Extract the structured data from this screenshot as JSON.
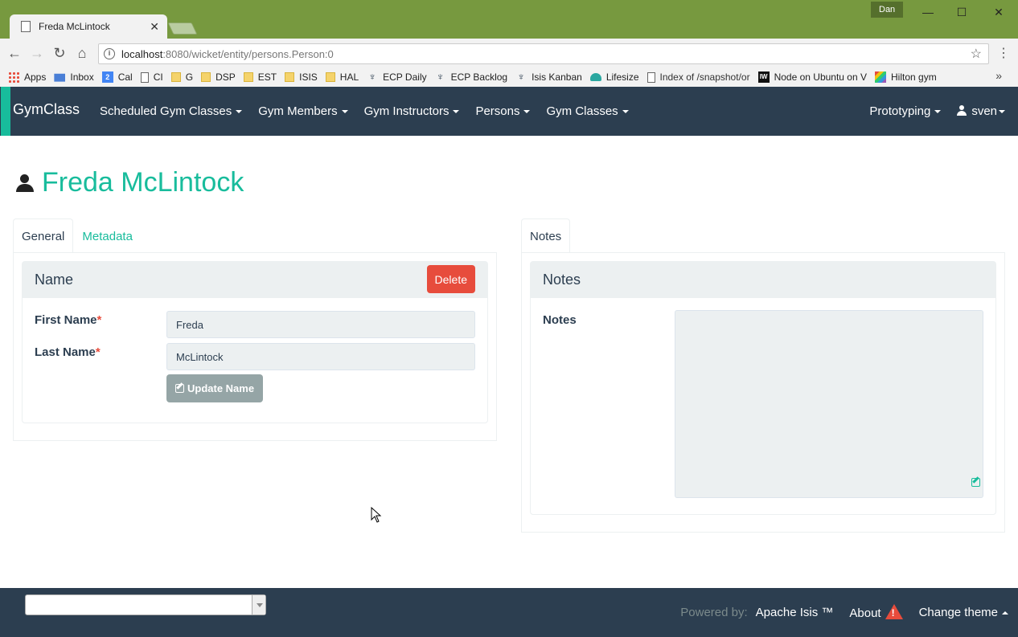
{
  "browser": {
    "tab_title": "Freda McLintock",
    "user": "Dan",
    "url_host": "localhost",
    "url_rest": ":8080/wicket/entity/persons.Person:0",
    "bookmarks": [
      {
        "label": "Apps",
        "icon": "apps-grid-icon"
      },
      {
        "label": "Inbox",
        "icon": "mail-icon"
      },
      {
        "label": "Cal",
        "icon": "calendar-icon"
      },
      {
        "label": "CI",
        "icon": "page-icon"
      },
      {
        "label": "G",
        "icon": "folder-icon"
      },
      {
        "label": "DSP",
        "icon": "folder-icon"
      },
      {
        "label": "EST",
        "icon": "folder-icon"
      },
      {
        "label": "ISIS",
        "icon": "folder-icon"
      },
      {
        "label": "HAL",
        "icon": "folder-icon"
      },
      {
        "label": "ECP Daily",
        "icon": "person-icon"
      },
      {
        "label": "ECP Backlog",
        "icon": "person-icon"
      },
      {
        "label": "Isis Kanban",
        "icon": "person-icon"
      },
      {
        "label": "Lifesize",
        "icon": "cloud-icon"
      },
      {
        "label": "Index of /snapshot/or",
        "icon": "page-icon"
      },
      {
        "label": "Node on Ubuntu on V",
        "icon": "iw-icon"
      },
      {
        "label": "Hilton gym",
        "icon": "stripe-icon"
      }
    ],
    "bookmarks_more": "»"
  },
  "navbar": {
    "brand": "GymClass",
    "items": [
      "Scheduled Gym Classes",
      "Gym Members",
      "Gym Instructors",
      "Persons",
      "Gym Classes"
    ],
    "prototyping": "Prototyping",
    "user": "sven"
  },
  "page": {
    "title": "Freda McLintock"
  },
  "left": {
    "tabs": [
      "General",
      "Metadata"
    ],
    "panel_title": "Name",
    "delete_label": "Delete",
    "first_name_label": "First Name",
    "first_name_value": "Freda",
    "last_name_label": "Last Name",
    "last_name_value": "McLintock",
    "required_marker": "*",
    "update_label": "Update Name"
  },
  "right": {
    "tabs": [
      "Notes"
    ],
    "panel_title": "Notes",
    "notes_label": "Notes",
    "notes_value": ""
  },
  "footer": {
    "theme_select_value": "",
    "powered_by": "Powered by:",
    "apache_isis": "Apache Isis ™",
    "about": "About",
    "change_theme": "Change theme"
  },
  "colors": {
    "accent": "#18bc9c",
    "navbar": "#2c3e50",
    "danger": "#e74c3c",
    "chrome": "#77993f"
  }
}
